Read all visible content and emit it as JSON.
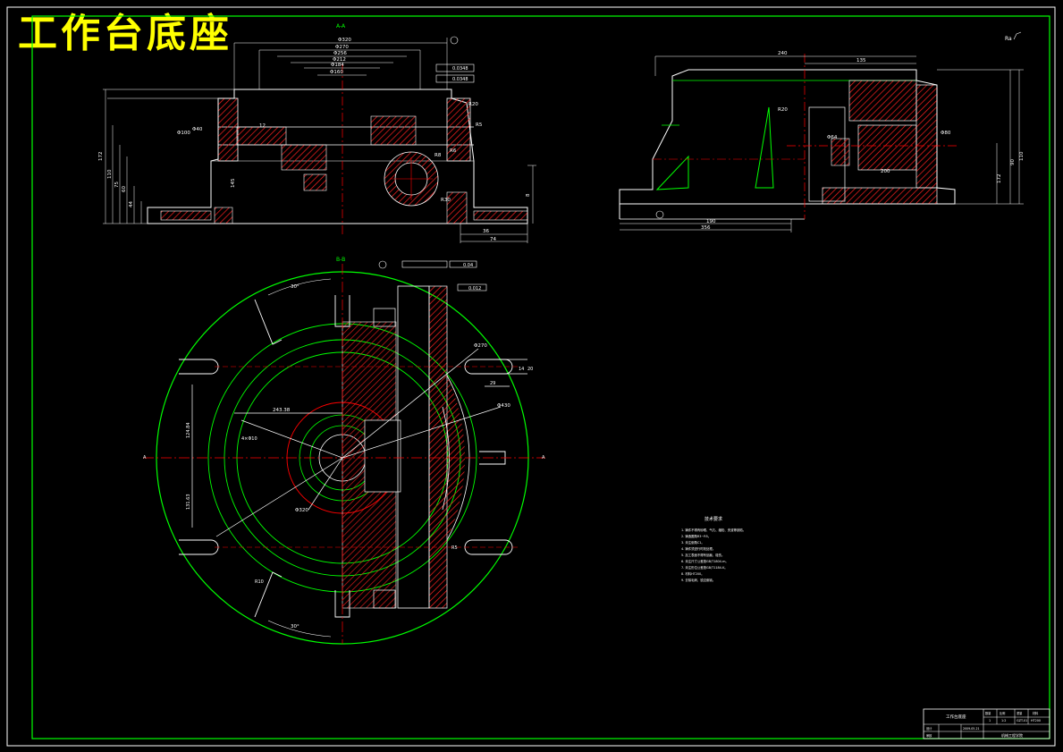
{
  "drawing": {
    "title": "工作台底座",
    "view_aa_label": "A-A",
    "view_bb_label": "B-B",
    "surface_mark": "Ra",
    "datum_label": "A"
  },
  "dims_aa": {
    "top_diameters": [
      "Φ320",
      "Φ270",
      "Φ256",
      "Φ212",
      "Φ184",
      "Φ160"
    ],
    "tol_1": "0.0348",
    "tol_2": "0.0348",
    "r20": "R20",
    "r5": "R5",
    "r6": "R6",
    "r30": "R30",
    "r8": "R8",
    "phi100": "Φ100",
    "phi40": "Φ40",
    "left_heights": [
      "172",
      "110",
      "75",
      "60",
      "44"
    ],
    "h55": "145",
    "h12": "12",
    "bottom_74": "74",
    "bottom_36": "36",
    "bottom_8": "8"
  },
  "dims_right": {
    "top_240": "240",
    "top_135": "135",
    "h_110": "110",
    "h_90": "90",
    "h_172": "172",
    "bot_190": "190",
    "bot_356": "356",
    "w_200": "200",
    "phi_80": "Φ80",
    "phi_64": "Φ64",
    "r_20": "R20"
  },
  "dims_bb": {
    "angle_top": "30°",
    "angle_bottom": "30°",
    "dia_270": "Φ270",
    "dia_430": "Φ430",
    "dia_320": "Φ320",
    "dim_243": "243.38",
    "dim_124": "124.84",
    "dim_131": "131.63",
    "dim_14": "14",
    "dim_20": "20",
    "dim_29": "29",
    "dim_4x": "4×Φ10",
    "r10": "R10",
    "r5": "R5",
    "tol_top": "0.04",
    "tol_mid": "0.012"
  },
  "tech_req": {
    "title": "技术要求",
    "lines": [
      "1. 铸件不得有砂眼、气孔、缩松、夹渣等缺陷。",
      "2. 铸造圆角R3~R5。",
      "3. 未注倒角C1。",
      "4. 铸件须进行时效处理。",
      "5. 加工表面不得有划痕、碰伤。",
      "6. 未注尺寸公差按GB/T1804-m。",
      "7. 未注形位公差按GB/T1184-K。",
      "8. 材料HT200。",
      "9. 去除毛刺，锐边倒钝。"
    ]
  },
  "title_block": {
    "part_name": "工作台底座",
    "material": "HT200",
    "scale": "1:2",
    "sheet": "1",
    "drawing_no": "GZT-01",
    "designer": "设计",
    "checker": "审核",
    "date": "2009-05-21",
    "company": "机械工程学院",
    "qty_label": "数量",
    "scale_label": "比例",
    "weight_label": "重量",
    "material_label": "材料"
  },
  "colors": {
    "frame": "#00ff00",
    "outline": "#ffffff",
    "centerline": "#ff0000",
    "hatch": "#ff0000",
    "title": "#ffff00"
  }
}
